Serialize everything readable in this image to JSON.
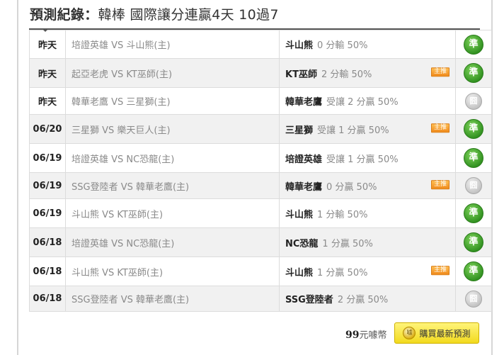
{
  "header": {
    "title_prefix": "預測紀錄：",
    "title_main": "韓棒 國際讓分連贏4天 10過7"
  },
  "records": [
    {
      "date": "昨天",
      "match": "培證英雄 VS 斗山熊(主)",
      "pick_team": "斗山熊",
      "pick_desc": "0 分輸 50%",
      "badge": "",
      "result": "準",
      "result_type": "hit"
    },
    {
      "date": "昨天",
      "match": "起亞老虎 VS KT巫師(主)",
      "pick_team": "KT巫師",
      "pick_desc": "2 分輸 50%",
      "badge": "主推",
      "result": "準",
      "result_type": "hit"
    },
    {
      "date": "昨天",
      "match": "韓華老鷹 VS 三星獅(主)",
      "pick_team": "韓華老鷹",
      "pick_desc": "受讓 2 分贏 50%",
      "badge": "",
      "result": "囧",
      "result_type": "miss"
    },
    {
      "date": "06/20",
      "match": "三星獅 VS 樂天巨人(主)",
      "pick_team": "三星獅",
      "pick_desc": "受讓 1 分贏 50%",
      "badge": "主推",
      "result": "準",
      "result_type": "hit"
    },
    {
      "date": "06/19",
      "match": "培證英雄 VS NC恐龍(主)",
      "pick_team": "培證英雄",
      "pick_desc": "受讓 1 分贏 50%",
      "badge": "",
      "result": "準",
      "result_type": "hit"
    },
    {
      "date": "06/19",
      "match": "SSG登陸者 VS 韓華老鷹(主)",
      "pick_team": "韓華老鷹",
      "pick_desc": "0 分贏 50%",
      "badge": "主推",
      "result": "囧",
      "result_type": "miss"
    },
    {
      "date": "06/19",
      "match": "斗山熊 VS KT巫師(主)",
      "pick_team": "斗山熊",
      "pick_desc": "1 分輸 50%",
      "badge": "",
      "result": "準",
      "result_type": "hit"
    },
    {
      "date": "06/18",
      "match": "培證英雄 VS NC恐龍(主)",
      "pick_team": "NC恐龍",
      "pick_desc": "1 分贏 50%",
      "badge": "",
      "result": "準",
      "result_type": "hit"
    },
    {
      "date": "06/18",
      "match": "斗山熊 VS KT巫師(主)",
      "pick_team": "斗山熊",
      "pick_desc": "1 分贏 50%",
      "badge": "主推",
      "result": "準",
      "result_type": "hit"
    },
    {
      "date": "06/18",
      "match": "SSG登陸者 VS 韓華老鷹(主)",
      "pick_team": "SSG登陸者",
      "pick_desc": "2 分贏 50%",
      "badge": "",
      "result": "囧",
      "result_type": "miss"
    }
  ],
  "footer": {
    "price_amount": "99",
    "price_unit": "元噱幣",
    "coin_glyph": "噱",
    "buy_label": "購買最新預測"
  },
  "colors": {
    "hit": "#3d9a2a",
    "miss": "#bdbdbd",
    "badge": "#f08a1c",
    "buy_button": "#f2da1e"
  },
  "icons": {
    "hit_result": "green-circle-icon",
    "miss_result": "gray-circle-icon",
    "buy_coin": "coin-icon"
  }
}
